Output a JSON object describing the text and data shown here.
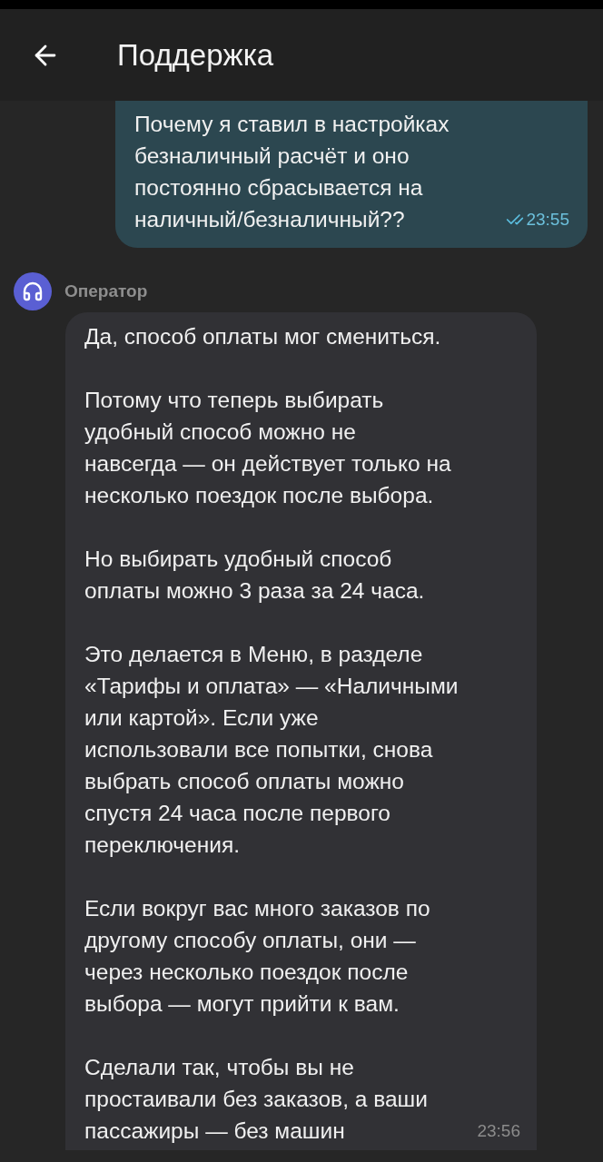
{
  "header": {
    "title": "Поддержка"
  },
  "messages": [
    {
      "kind": "outgoing",
      "paragraphs": [
        "Почему я ставил в настройках\nбезналичный расчёт и оно\nпостоянно сбрасывается на\nналичный/безналичный??"
      ],
      "time": "23:55",
      "read": true
    },
    {
      "kind": "incoming",
      "sender": "Оператор",
      "paragraphs": [
        "Да, способ оплаты мог смениться.",
        "Потому что теперь выбирать\nудобный способ можно не\nнавсегда — он действует только на\nнесколько поездок после выбора.",
        "Но выбирать удобный способ\nоплаты можно 3 раза за 24 часа.",
        "Это делается в Меню, в разделе\n«Тарифы и оплата» — «Наличными\nили картой». Если уже\nиспользовали все попытки, снова\nвыбрать способ оплаты можно\nспустя 24 часа после первого\nпереключения.",
        "Если вокруг вас много заказов по\nдругому способу оплаты, они —\nчерез несколько поездок после\nвыбора — могут прийти к вам.",
        "Сделали так, чтобы вы не\nпростаивали без заказов, а ваши\nпассажиры — без машин"
      ],
      "time": "23:56"
    }
  ]
}
